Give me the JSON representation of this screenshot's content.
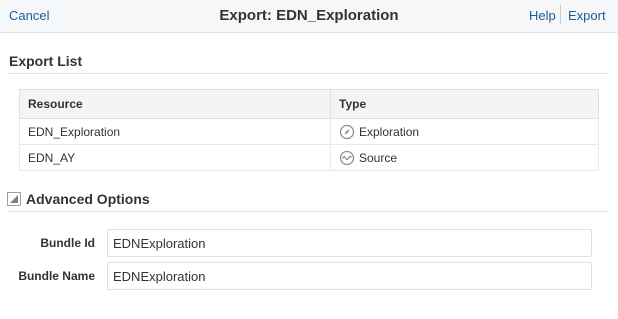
{
  "header": {
    "cancel_label": "Cancel",
    "title": "Export: EDN_Exploration",
    "help_label": "Help",
    "export_label": "Export"
  },
  "export_list": {
    "title": "Export List",
    "columns": [
      "Resource",
      "Type"
    ],
    "rows": [
      {
        "resource": "EDN_Exploration",
        "type": "Exploration",
        "icon": "compass-icon"
      },
      {
        "resource": "EDN_AY",
        "type": "Source",
        "icon": "wave-icon"
      }
    ]
  },
  "advanced": {
    "title": "Advanced Options",
    "toggle_icon": "collapse-triangle-icon",
    "bundle_id_label": "Bundle Id",
    "bundle_id_value": "EDNExploration",
    "bundle_name_label": "Bundle Name",
    "bundle_name_value": "EDNExploration"
  },
  "colors": {
    "link": "#1a5c9a",
    "header_bg": "#f6f7f8",
    "table_header_bg": "#f3f4f5"
  }
}
